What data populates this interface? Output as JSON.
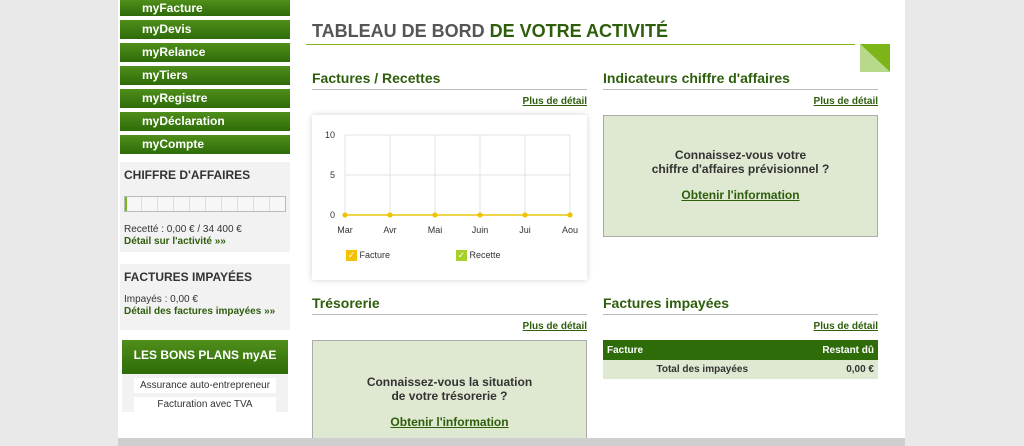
{
  "nav": [
    {
      "label": "myFacture"
    },
    {
      "label": "myDevis"
    },
    {
      "label": "myRelance"
    },
    {
      "label": "myTiers"
    },
    {
      "label": "myRegistre"
    },
    {
      "label": "myDéclaration"
    },
    {
      "label": "myCompte"
    }
  ],
  "ca_box": {
    "title": "CHIFFRE D'AFFAIRES",
    "recette": "Recetté : 0,00 € / 34 400 €",
    "detail_link": "Détail sur l'activité »»",
    "progress": 0
  },
  "impayees_box": {
    "title": "FACTURES IMPAYÉES",
    "impayes": "Impayés : 0,00 €",
    "detail_link": "Détail des factures impayées »»"
  },
  "bons_plans": {
    "title": "LES BONS PLANS myAE",
    "items": [
      "Assurance auto-entrepreneur",
      "Facturation avec TVA"
    ]
  },
  "header": {
    "title_part1": "TABLEAU DE BORD ",
    "title_part2": "DE VOTRE ACTIVITÉ"
  },
  "factures_recettes": {
    "title": "Factures / Recettes",
    "detail": "Plus de détail"
  },
  "indicateurs": {
    "title": "Indicateurs chiffre d'affaires",
    "detail": "Plus de détail",
    "line1": "Connaissez-vous votre",
    "line2": "chiffre d'affaires prévisionnel ?",
    "link": "Obtenir l'information"
  },
  "tresorerie": {
    "title": "Trésorerie",
    "detail": "Plus de détail",
    "line1": "Connaissez-vous la situation",
    "line2": "de votre trésorerie ?",
    "link": "Obtenir l'information"
  },
  "factures_impayees": {
    "title": "Factures impayées",
    "detail": "Plus de détail",
    "col1": "Facture",
    "col2": "Restant dû",
    "total_label": "Total des impayées",
    "total_value": "0,00 €"
  },
  "colors": {
    "accent": "#2e6b09",
    "line": "#a8d02a",
    "facture": "#f2c200",
    "recette": "#a8d02a"
  },
  "chart_data": {
    "type": "line",
    "categories": [
      "Mar",
      "Avr",
      "Mai",
      "Juin",
      "Jui",
      "Aou"
    ],
    "series": [
      {
        "name": "Facture",
        "values": [
          0,
          0,
          0,
          0,
          0,
          0
        ]
      },
      {
        "name": "Recette",
        "values": [
          0,
          0,
          0,
          0,
          0,
          0
        ]
      }
    ],
    "yticks": [
      0,
      5,
      10
    ],
    "ylim": [
      0,
      10
    ],
    "grid": true,
    "legend": "bottom"
  }
}
